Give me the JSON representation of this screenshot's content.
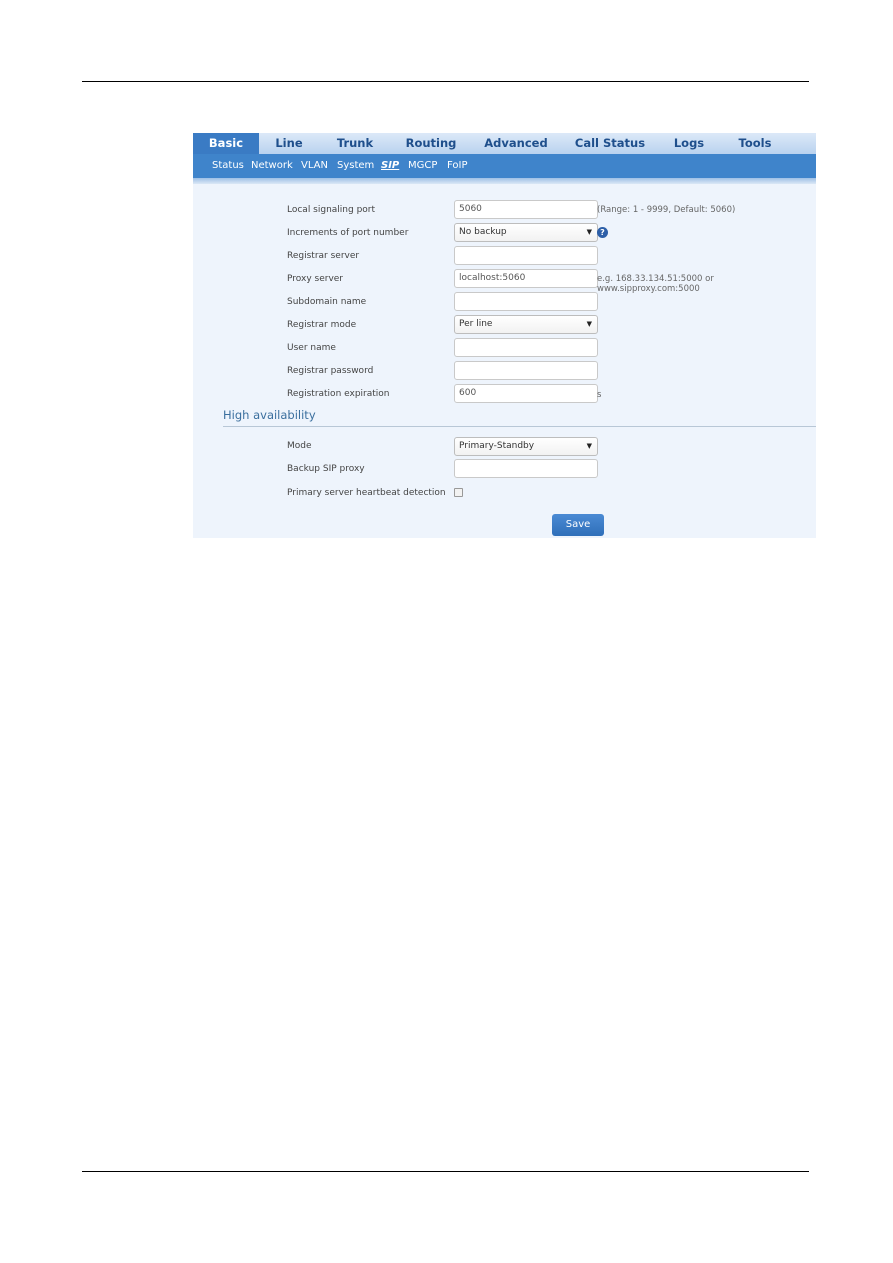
{
  "main_nav": [
    {
      "label": "Basic",
      "active": true
    },
    {
      "label": "Line"
    },
    {
      "label": "Trunk"
    },
    {
      "label": "Routing"
    },
    {
      "label": "Advanced"
    },
    {
      "label": "Call Status"
    },
    {
      "label": "Logs"
    },
    {
      "label": "Tools"
    }
  ],
  "sub_nav": [
    {
      "label": "Status"
    },
    {
      "label": "Network"
    },
    {
      "label": "VLAN"
    },
    {
      "label": "System"
    },
    {
      "label": "SIP",
      "active": true
    },
    {
      "label": "MGCP"
    },
    {
      "label": "FoIP"
    }
  ],
  "form": {
    "local_signaling_port": {
      "label": "Local signaling port",
      "value": "5060",
      "hint": "(Range: 1 - 9999, Default: 5060)"
    },
    "increments_of_port_number": {
      "label": "Increments of port number",
      "value": "No backup",
      "help_icon": "?"
    },
    "registrar_server": {
      "label": "Registrar server",
      "value": ""
    },
    "proxy_server": {
      "label": "Proxy server",
      "value": "localhost:5060",
      "hint": "e.g. 168.33.134.51:5000 or www.sipproxy.com:5000"
    },
    "subdomain_name": {
      "label": "Subdomain name",
      "value": ""
    },
    "registrar_mode": {
      "label": "Registrar mode",
      "value": "Per line"
    },
    "user_name": {
      "label": "User name",
      "value": ""
    },
    "registrar_password": {
      "label": "Registrar password",
      "value": ""
    },
    "registration_expiration": {
      "label": "Registration expiration",
      "value": "600",
      "unit": "s"
    }
  },
  "high_availability": {
    "title": "High availability",
    "mode": {
      "label": "Mode",
      "value": "Primary-Standby"
    },
    "backup_sip_proxy": {
      "label": "Backup SIP proxy",
      "value": ""
    },
    "heartbeat": {
      "label": "Primary server heartbeat detection",
      "checked": false
    }
  },
  "actions": {
    "save_label": "Save"
  },
  "caret": "▼"
}
